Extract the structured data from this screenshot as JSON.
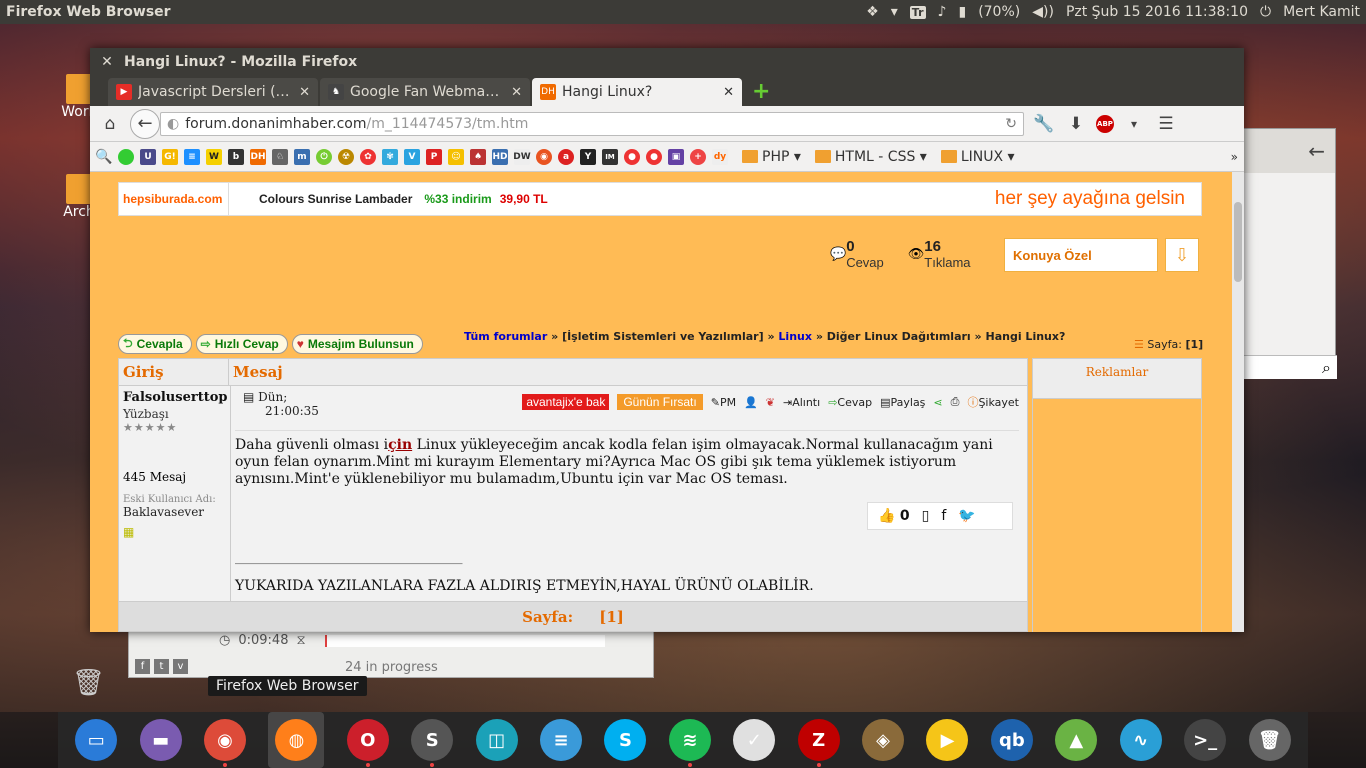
{
  "panel": {
    "app_title": "Firefox Web Browser",
    "tr": "Tr",
    "battery": "(70%)",
    "clock": "Pzt Şub 15 2016 11:38:10",
    "user": "Mert Kamit"
  },
  "desktop": {
    "icon1": "Work",
    "icon2": "Arch"
  },
  "window": {
    "title": "Hangi Linux? - Mozilla Firefox",
    "tabs": [
      {
        "label": "Javascript Dersleri (…",
        "favicon_color": "#e52d27"
      },
      {
        "label": "Google Fan Webma…",
        "favicon_color": "#444444"
      },
      {
        "label": "Hangi Linux?",
        "favicon_color": "#f06a00",
        "favicon_text": "DH"
      }
    ],
    "url_host": "forum.donanimhaber.com",
    "url_path": "/m_114474573/tm.htm",
    "abp": "ABP",
    "bookmark_folders": [
      "PHP ▾",
      "HTML - CSS ▾",
      "LINUX ▾"
    ]
  },
  "page": {
    "ad": {
      "logo": "hepsiburada.com",
      "product": "Colours Sunrise Lambader",
      "discount": "%33 indirim",
      "price": "39,90 TL",
      "slogan": "her şey ayağına gelsin"
    },
    "stats": {
      "answers": "0",
      "answers_label": "Cevap",
      "views": "16",
      "views_label": "Tıklama"
    },
    "konu_btn": "Konuya Özel",
    "buttons": {
      "reply": "Cevapla",
      "quick_reply": "Hızlı Cevap",
      "find_msg": "Mesajım Bulunsun"
    },
    "breadcrumb": {
      "all_forums": "Tüm forumlar",
      "sep": "»",
      "cat": "[İşletim Sistemleri ve Yazılımlar]",
      "linux": "Linux",
      "sub": "Diğer Linux Dağıtımları",
      "topic": "Hangi Linux?"
    },
    "page_label": "Sayfa:",
    "page_num": "[1]",
    "table_header": {
      "login": "Giriş",
      "message": "Mesaj"
    },
    "ads_header": "Reklamlar",
    "post": {
      "username": "Falsoluserttop",
      "rank": "Yüzbaşı",
      "stars": "★★★★★",
      "msg_count": "445 Mesaj",
      "old_name_label": "Eski Kullanıcı Adı:",
      "old_name": "Baklavasever",
      "date": "Dün;",
      "time": "21:00:35",
      "badge1": "avantajix'e bak",
      "badge2": "Günün Fırsatı",
      "tools": {
        "pm": "PM",
        "quote": "Alıntı",
        "reply": "Cevap",
        "share": "Paylaş",
        "report": "Şikayet"
      },
      "text_before": "Daha güvenli olması i",
      "text_hl": "çin",
      "text_after": " Linux yükleyeceğim ancak kodla felan işim olmayacak.Normal kullanacağım yani oyun felan oynarım.Mint mi kurayım Elementary mi?Ayrıca Mac OS gibi şık tema yüklemek istiyorum aynısını.Mint'e yüklenebiliyor mu bulamadım,Ubuntu için var Mac OS teması.",
      "likes": "0",
      "signature_line": "___________________________________",
      "signature": "YUKARIDA YAZILANLARA FAZLA ALDIRIŞ ETMEYİN,HAYAL ÜRÜNÜ OLABİLİR."
    },
    "pager_label": "Sayfa:",
    "pager_num": "[1]"
  },
  "download": {
    "time": "0:09:48",
    "status": "24 in progress"
  },
  "tooltip": "Firefox Web Browser",
  "dock_apps": [
    {
      "name": "files",
      "color": "#2a7bd8"
    },
    {
      "name": "folder",
      "color": "#7a5bb0"
    },
    {
      "name": "chrome",
      "color": "#dd4b39"
    },
    {
      "name": "firefox",
      "color": "#ff7f1a"
    },
    {
      "name": "opera",
      "color": "#cc1f2b"
    },
    {
      "name": "sublime",
      "color": "#555"
    },
    {
      "name": "app-cyan",
      "color": "#1ba1b8"
    },
    {
      "name": "text-editor",
      "color": "#3a9ad9"
    },
    {
      "name": "skype",
      "color": "#00aff0"
    },
    {
      "name": "spotify",
      "color": "#1db954"
    },
    {
      "name": "todo",
      "color": "#e0e0e0"
    },
    {
      "name": "filezilla",
      "color": "#bf0000"
    },
    {
      "name": "gimp",
      "color": "#8a6a3a"
    },
    {
      "name": "player",
      "color": "#f5c518"
    },
    {
      "name": "qbittorrent",
      "color": "#1e62ad"
    },
    {
      "name": "android-studio",
      "color": "#6ab344"
    },
    {
      "name": "system-monitor",
      "color": "#2a9fd6"
    },
    {
      "name": "terminal",
      "color": "#444"
    },
    {
      "name": "trash",
      "color": "#666"
    }
  ]
}
